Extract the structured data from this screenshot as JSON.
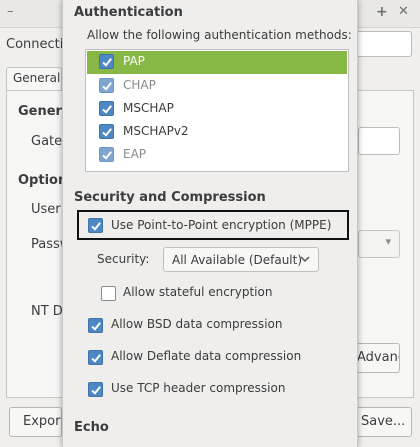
{
  "background_window": {
    "minimize_glyph": "–",
    "maximize_glyph": "+",
    "close_glyph": "✕",
    "connection_label": "Connection name:",
    "tab_label": "General",
    "general_section": "General",
    "gateway_label": "Gateway:",
    "options_section": "Options",
    "user_label": "User name:",
    "password_label": "Password:",
    "nt_domain_label": "NT Domain:",
    "advanced_button": "Advanced...",
    "export_button": "Export...",
    "save_button": "Save..."
  },
  "dialog": {
    "authentication": {
      "heading": "Authentication",
      "description": "Allow the following authentication methods:",
      "methods": [
        {
          "label": "PAP",
          "checked": true,
          "selected": true,
          "dim": false
        },
        {
          "label": "CHAP",
          "checked": true,
          "selected": false,
          "dim": true
        },
        {
          "label": "MSCHAP",
          "checked": true,
          "selected": false,
          "dim": false
        },
        {
          "label": "MSCHAPv2",
          "checked": true,
          "selected": false,
          "dim": false
        },
        {
          "label": "EAP",
          "checked": true,
          "selected": false,
          "dim": true
        }
      ]
    },
    "security": {
      "heading": "Security and Compression",
      "mppe_label": "Use Point-to-Point encryption (MPPE)",
      "security_label": "Security:",
      "security_value": "All Available (Default)",
      "stateful_label": "Allow stateful encryption",
      "bsd_label": "Allow BSD data compression",
      "deflate_label": "Allow Deflate data compression",
      "tcp_label": "Use TCP header compression"
    },
    "echo": {
      "heading": "Echo"
    }
  },
  "colors": {
    "selected_row": "#87b845",
    "checkbox": "#4d88c4",
    "dialog_bg": "#efeeec"
  }
}
